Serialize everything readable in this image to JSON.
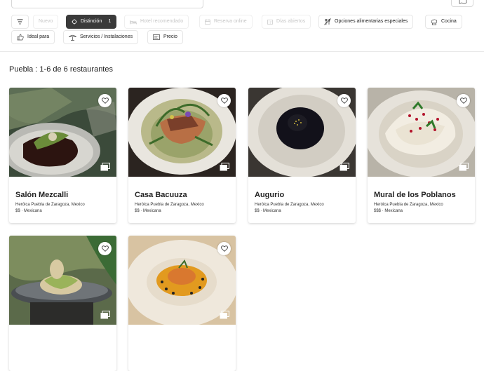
{
  "filters": {
    "chips": [
      {
        "label": "",
        "icon": "sort-icon",
        "state": "normal"
      },
      {
        "label": "Nuevo",
        "icon": "",
        "state": "disabled"
      },
      {
        "label": "Distinción",
        "icon": "distinction-icon",
        "state": "active",
        "count": "1"
      },
      {
        "label": "Hotel recomendado",
        "icon": "bed-icon",
        "state": "disabled"
      },
      {
        "label": "Reserva online",
        "icon": "calendar-icon",
        "state": "disabled"
      },
      {
        "label": "Días abiertos",
        "icon": "days-icon",
        "state": "disabled"
      },
      {
        "label": "Opciones alimentarias especiales",
        "icon": "no-fork-icon",
        "state": "normal"
      },
      {
        "label": "Cocina",
        "icon": "chef-hat-icon",
        "state": "normal"
      },
      {
        "label": "Ideal para",
        "icon": "thumbs-up-icon",
        "state": "normal"
      },
      {
        "label": "Servicios / Instalaciones",
        "icon": "parasol-icon",
        "state": "normal"
      },
      {
        "label": "Precio",
        "icon": "price-icon",
        "state": "normal"
      }
    ]
  },
  "results": {
    "title": "Puebla : 1-6 de 6 restaurantes"
  },
  "restaurants": [
    {
      "name": "Salón Mezcalli",
      "city": "Heróica Puebla de Zaragoza, Mexico",
      "meta": "$$ · Mexicana",
      "photo": "mole-dish-photo"
    },
    {
      "name": "Casa Bacuuza",
      "city": "Heróica Puebla de Zaragoza, Mexico",
      "meta": "$$ · Mexicana",
      "photo": "green-sauce-dish-photo"
    },
    {
      "name": "Augurio",
      "city": "Heróica Puebla de Zaragoza, Mexico",
      "meta": "$$ · Mexicana",
      "photo": "black-mole-plate-photo"
    },
    {
      "name": "Mural de los Poblanos",
      "city": "Heróica Puebla de Zaragoza, Mexico",
      "meta": "$$$ · Mexicana",
      "photo": "chile-en-nogada-photo"
    },
    {
      "name": "",
      "city": "",
      "meta": "",
      "photo": "tostada-plate-photo"
    },
    {
      "name": "",
      "city": "",
      "meta": "",
      "photo": "fish-plate-photo"
    }
  ],
  "colors": {
    "active_chip": "#3a3a3a",
    "disabled_text": "#c6c6c6"
  }
}
